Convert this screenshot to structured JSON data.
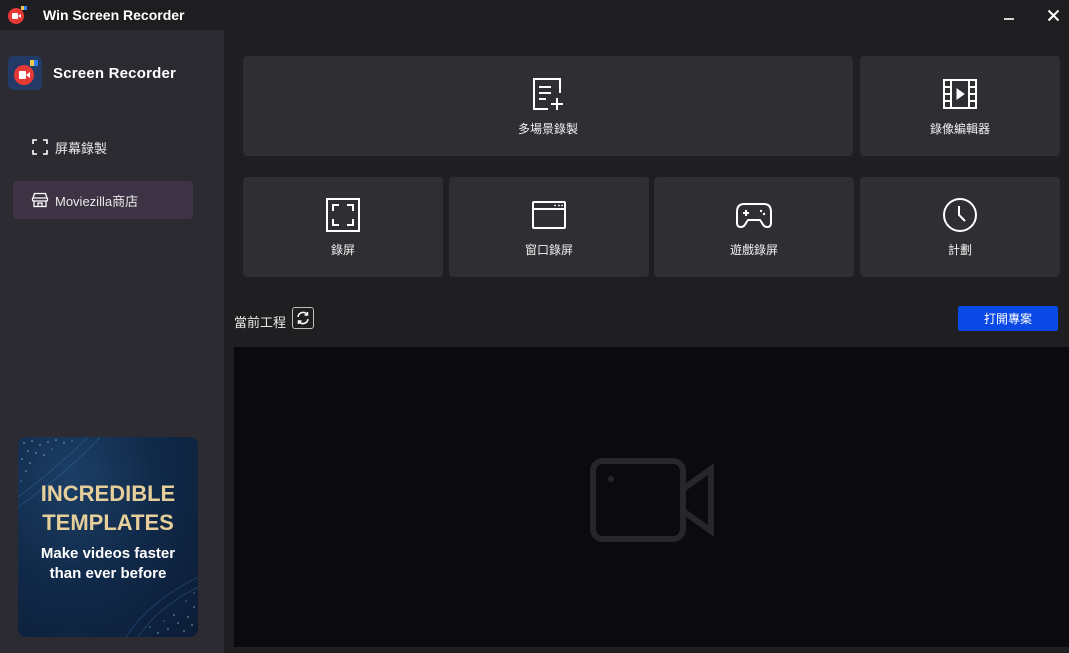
{
  "titlebar": {
    "title": "Win Screen Recorder"
  },
  "sidebar": {
    "brand": "Screen Recorder",
    "items": [
      {
        "label": "屏幕錄製",
        "icon": "screen-capture-icon"
      },
      {
        "label": "Moviezilla商店",
        "icon": "store-icon",
        "active": true
      }
    ],
    "promo": {
      "headline_1": "INCREDIBLE",
      "headline_2": "TEMPLATES",
      "sub_1": "Make videos faster",
      "sub_2": "than ever before"
    }
  },
  "main": {
    "tiles": [
      {
        "label": "多場景錄製",
        "icon": "multi-scene-icon"
      },
      {
        "label": "錄像編輯器",
        "icon": "film-editor-icon"
      },
      {
        "label": "錄屏",
        "icon": "screen-record-icon"
      },
      {
        "label": "窗口錄屏",
        "icon": "window-record-icon"
      },
      {
        "label": "遊戲錄屏",
        "icon": "gamepad-icon"
      },
      {
        "label": "計劃",
        "icon": "clock-icon"
      }
    ],
    "current_project_label": "當前工程",
    "open_project_button": "打開專案"
  },
  "colors": {
    "accent_blue": "#0a49e6",
    "brand_red": "#e53935",
    "promo_gold": "#e6cf9a",
    "active_nav": "#3d3344"
  }
}
